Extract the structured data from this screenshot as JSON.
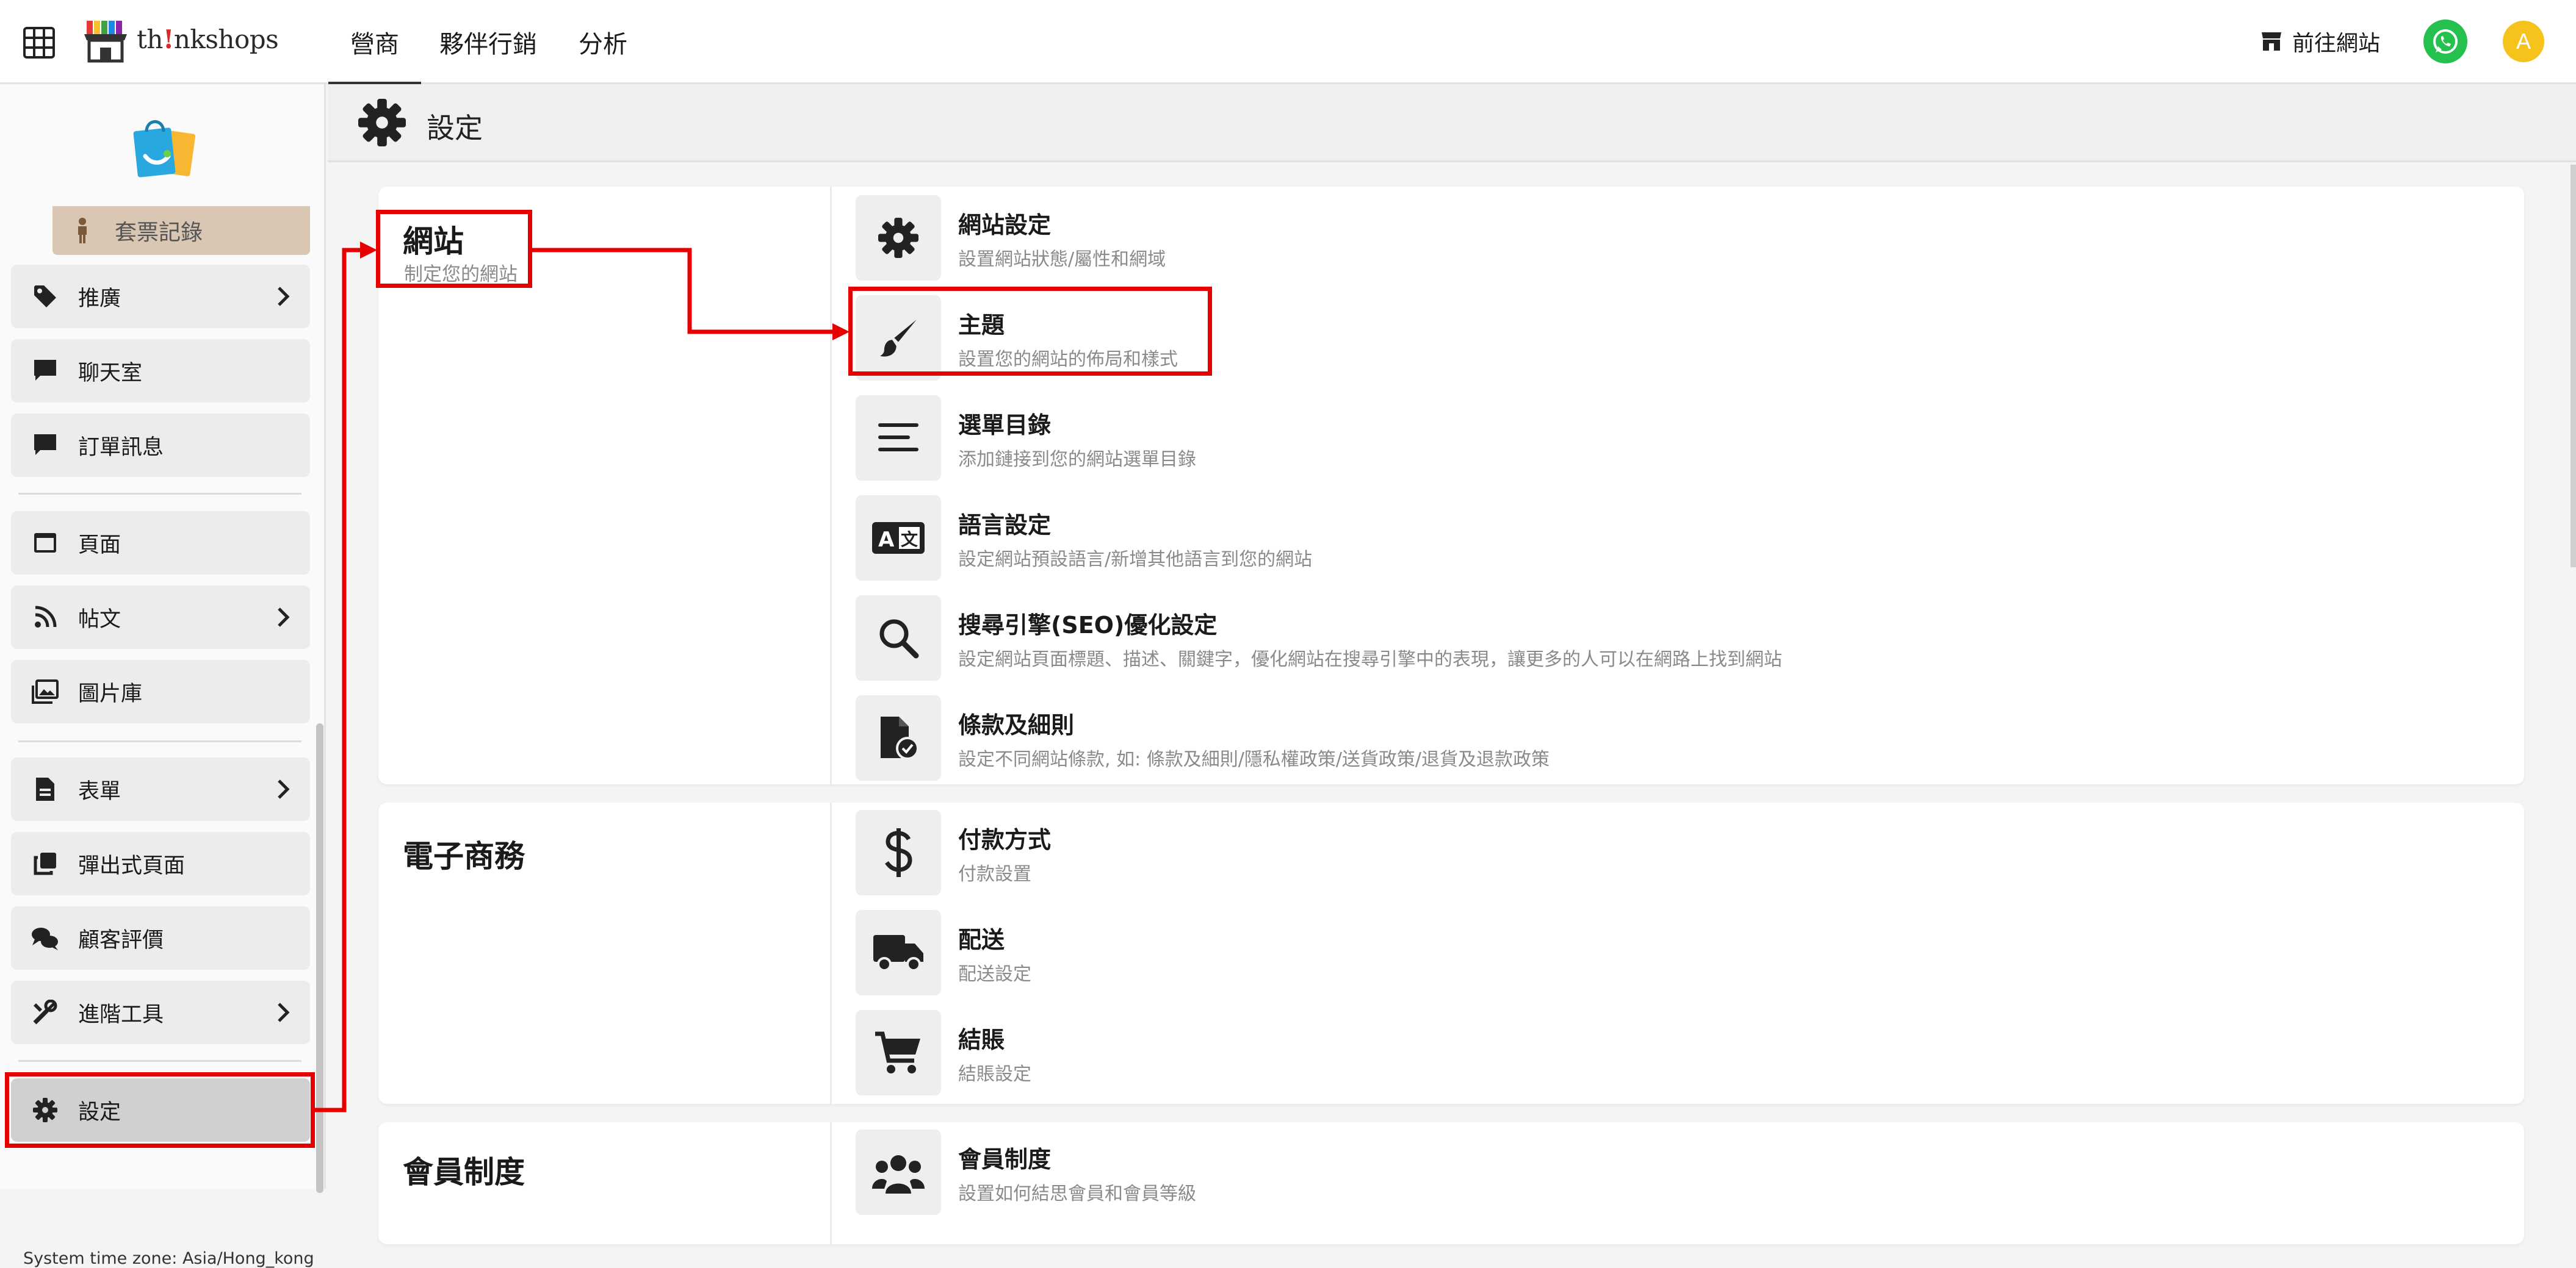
{
  "topbar": {
    "brand_prefix": "th",
    "brand_exclaim": "!",
    "brand_suffix": "nkshops",
    "tabs": [
      {
        "label": "營商",
        "active": true
      },
      {
        "label": "夥伴行銷",
        "active": false
      },
      {
        "label": "分析",
        "active": false
      }
    ],
    "goto_site": "前往網站",
    "avatar_initial": "A"
  },
  "sidebar": {
    "partial_item": "套票記錄",
    "items": [
      {
        "label": "推廣",
        "icon": "tag-icon",
        "has_submenu": true
      },
      {
        "label": "聊天室",
        "icon": "chat-icon",
        "has_submenu": false
      },
      {
        "label": "訂單訊息",
        "icon": "message-icon",
        "has_submenu": false
      },
      {
        "label": "頁面",
        "icon": "page-icon",
        "has_submenu": false
      },
      {
        "label": "帖文",
        "icon": "post-icon",
        "has_submenu": true
      },
      {
        "label": "圖片庫",
        "icon": "gallery-icon",
        "has_submenu": false
      },
      {
        "label": "表單",
        "icon": "form-icon",
        "has_submenu": true
      },
      {
        "label": "彈出式頁面",
        "icon": "popup-icon",
        "has_submenu": false
      },
      {
        "label": "顧客評價",
        "icon": "reviews-icon",
        "has_submenu": false
      },
      {
        "label": "進階工具",
        "icon": "tools-icon",
        "has_submenu": true
      },
      {
        "label": "設定",
        "icon": "gear-icon",
        "has_submenu": false,
        "active": true
      }
    ],
    "timezone": "System time zone: Asia/Hong_kong"
  },
  "page": {
    "title": "設定"
  },
  "sections": {
    "website": {
      "title": "網站",
      "subtitle": "制定您的網站",
      "rows": [
        {
          "title": "網站設定",
          "desc": "設置網站狀態/屬性和網域",
          "icon": "gear-icon"
        },
        {
          "title": "主題",
          "desc": "設置您的網站的佈局和樣式",
          "icon": "paintbrush-icon"
        },
        {
          "title": "選單目錄",
          "desc": "添加鏈接到您的網站選單目錄",
          "icon": "menu-lines-icon"
        },
        {
          "title": "語言設定",
          "desc": "設定網站預設語言/新增其他語言到您的網站",
          "icon": "translate-icon"
        },
        {
          "title": "搜尋引擎(SEO)優化設定",
          "desc": "設定網站頁面標題、描述、關鍵字，優化網站在搜尋引擎中的表現，讓更多的人可以在網路上找到網站",
          "icon": "search-icon"
        },
        {
          "title": "條款及細則",
          "desc": "設定不同網站條款, 如: 條款及細則/隱私權政策/送貨政策/退貨及退款政策",
          "icon": "document-check-icon"
        }
      ]
    },
    "ecommerce": {
      "title": "電子商務",
      "rows": [
        {
          "title": "付款方式",
          "desc": "付款設置",
          "icon": "dollar-icon"
        },
        {
          "title": "配送",
          "desc": "配送設定",
          "icon": "truck-icon"
        },
        {
          "title": "結賬",
          "desc": "結賬設定",
          "icon": "cart-icon"
        }
      ]
    },
    "membership": {
      "title": "會員制度",
      "rows": [
        {
          "title": "會員制度",
          "desc": "設置如何結思會員和會員等級",
          "icon": "users-icon"
        }
      ]
    }
  },
  "colors": {
    "annotation_red": "#e60000",
    "whatsapp_green": "#25c04e",
    "avatar_yellow": "#f6c21c",
    "active_sidebar": "#d0d0d0"
  }
}
